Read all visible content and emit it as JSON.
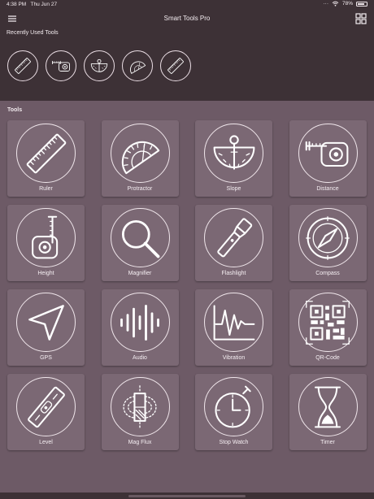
{
  "status_bar": {
    "time": "4:38 PM",
    "date": "Thu Jun 27",
    "battery": "78%",
    "battery_level": 0.78
  },
  "header": {
    "title": "Smart Tools Pro",
    "menu_icon": "hamburger-icon",
    "grid_icon": "grid-view-icon"
  },
  "recent": {
    "title": "Recently Used Tools",
    "items": [
      {
        "icon": "ruler-icon"
      },
      {
        "icon": "distance-icon"
      },
      {
        "icon": "slope-icon"
      },
      {
        "icon": "protractor-icon"
      },
      {
        "icon": "ruler-icon"
      }
    ]
  },
  "tools": {
    "title": "Tools",
    "items": [
      {
        "label": "Ruler",
        "icon": "ruler-icon"
      },
      {
        "label": "Protractor",
        "icon": "protractor-icon"
      },
      {
        "label": "Slope",
        "icon": "slope-icon"
      },
      {
        "label": "Distance",
        "icon": "distance-icon"
      },
      {
        "label": "Height",
        "icon": "height-icon"
      },
      {
        "label": "Magnifier",
        "icon": "magnifier-icon"
      },
      {
        "label": "Flashlight",
        "icon": "flashlight-icon"
      },
      {
        "label": "Compass",
        "icon": "compass-icon"
      },
      {
        "label": "GPS",
        "icon": "gps-icon"
      },
      {
        "label": "Audio",
        "icon": "audio-icon"
      },
      {
        "label": "Vibration",
        "icon": "vibration-icon"
      },
      {
        "label": "QR-Code",
        "icon": "qr-code-icon"
      },
      {
        "label": "Level",
        "icon": "level-icon"
      },
      {
        "label": "Mag Flux",
        "icon": "mag-flux-icon"
      },
      {
        "label": "Stop Watch",
        "icon": "stopwatch-icon"
      },
      {
        "label": "Timer",
        "icon": "hourglass-icon"
      }
    ]
  },
  "colors": {
    "header_bg": "#3d3136",
    "body_bg": "#6d5a66",
    "tile_bg": "#7b6874"
  }
}
